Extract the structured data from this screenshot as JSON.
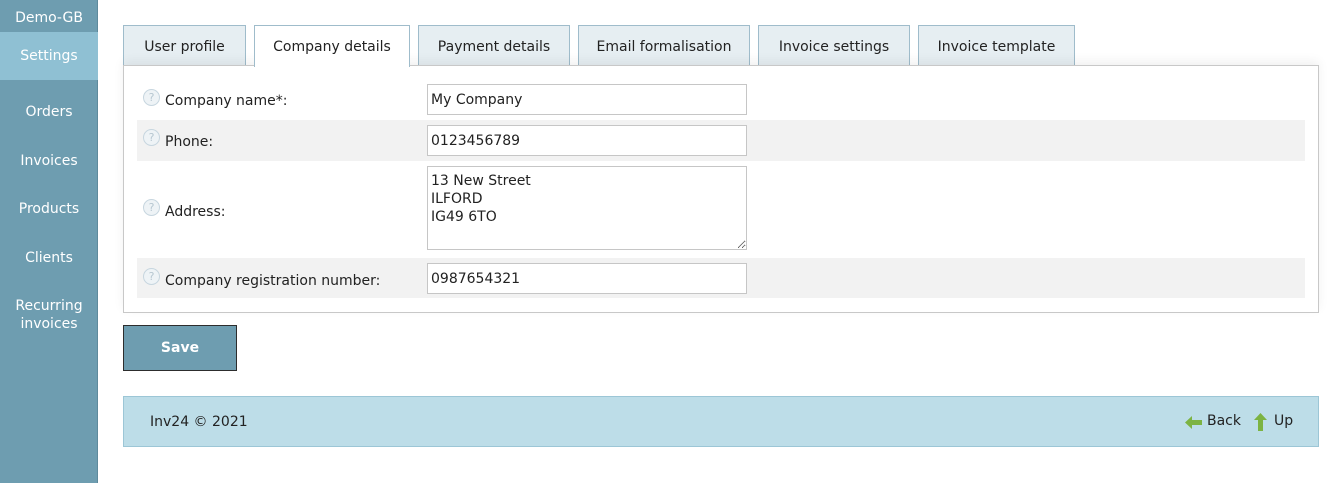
{
  "sidebar": {
    "brand": "Demo-GB",
    "items": [
      {
        "label": "Settings"
      },
      {
        "label": "Orders"
      },
      {
        "label": "Invoices"
      },
      {
        "label": "Products"
      },
      {
        "label": "Clients"
      },
      {
        "label": "Recurring invoices"
      }
    ],
    "active_item": "Settings"
  },
  "tabs": [
    {
      "label": "User profile"
    },
    {
      "label": "Company details"
    },
    {
      "label": "Payment details"
    },
    {
      "label": "Email formalisation"
    },
    {
      "label": "Invoice settings"
    },
    {
      "label": "Invoice template"
    }
  ],
  "active_tab": "Company details",
  "form": {
    "company_name": {
      "label": "Company name*:",
      "value": "My Company"
    },
    "phone": {
      "label": "Phone:",
      "value": "0123456789"
    },
    "address": {
      "label": "Address:",
      "value": "13 New Street\nILFORD\nIG49 6TO"
    },
    "registration": {
      "label": "Company registration number:",
      "value": "0987654321"
    },
    "help_icon_glyph": "?"
  },
  "save_label": "Save",
  "footer": {
    "copyright": "Inv24 © 2021",
    "back_label": "Back",
    "up_label": "Up"
  },
  "colors": {
    "sidebar": "#6e9db0",
    "sidebar_active": "#8fc0d3",
    "footer": "#bddde8",
    "arrow_green": "#7cb342"
  }
}
